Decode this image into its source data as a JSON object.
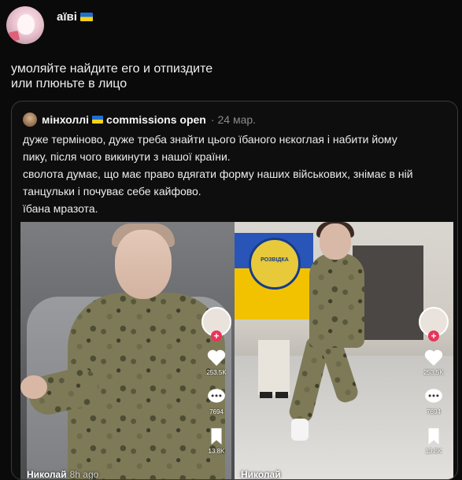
{
  "post": {
    "author_name": "аїві",
    "text_lines": [
      "умоляйте найдите его и отпиздите",
      "или плюньте в лицо"
    ]
  },
  "quote": {
    "author_name": "мінхоллі",
    "author_suffix": "commissions open",
    "separator": "·",
    "date": "24 мар.",
    "body_lines": [
      "дуже терміново, дуже треба знайти цього їбаного нєкоглая і набити йому",
      "пику, після чого викинути з нашої країни.",
      "сволота думає, що має право вдягати форму наших військових, знімає в ній",
      "танцульки і почуває себе кайфово.",
      "їбана мразота."
    ]
  },
  "media": [
    {
      "likes": "253.5K",
      "comments": "7694",
      "saves": "13.8K",
      "username": "Николай",
      "ago": "8h ago"
    },
    {
      "likes": "253.5K",
      "comments": "7694",
      "saves": "13.8K",
      "username": "Николай",
      "emblem": "РОЗВІДКА"
    }
  ],
  "colors": {
    "background": "#0a0a0a",
    "flag_blue": "#1f6fd1",
    "flag_yellow": "#f7d21b",
    "tiktok_plus": "#e8355a"
  },
  "icons": [
    "heart-icon",
    "comment-icon",
    "bookmark-icon",
    "plus-icon",
    "ukraine-flag-icon"
  ]
}
